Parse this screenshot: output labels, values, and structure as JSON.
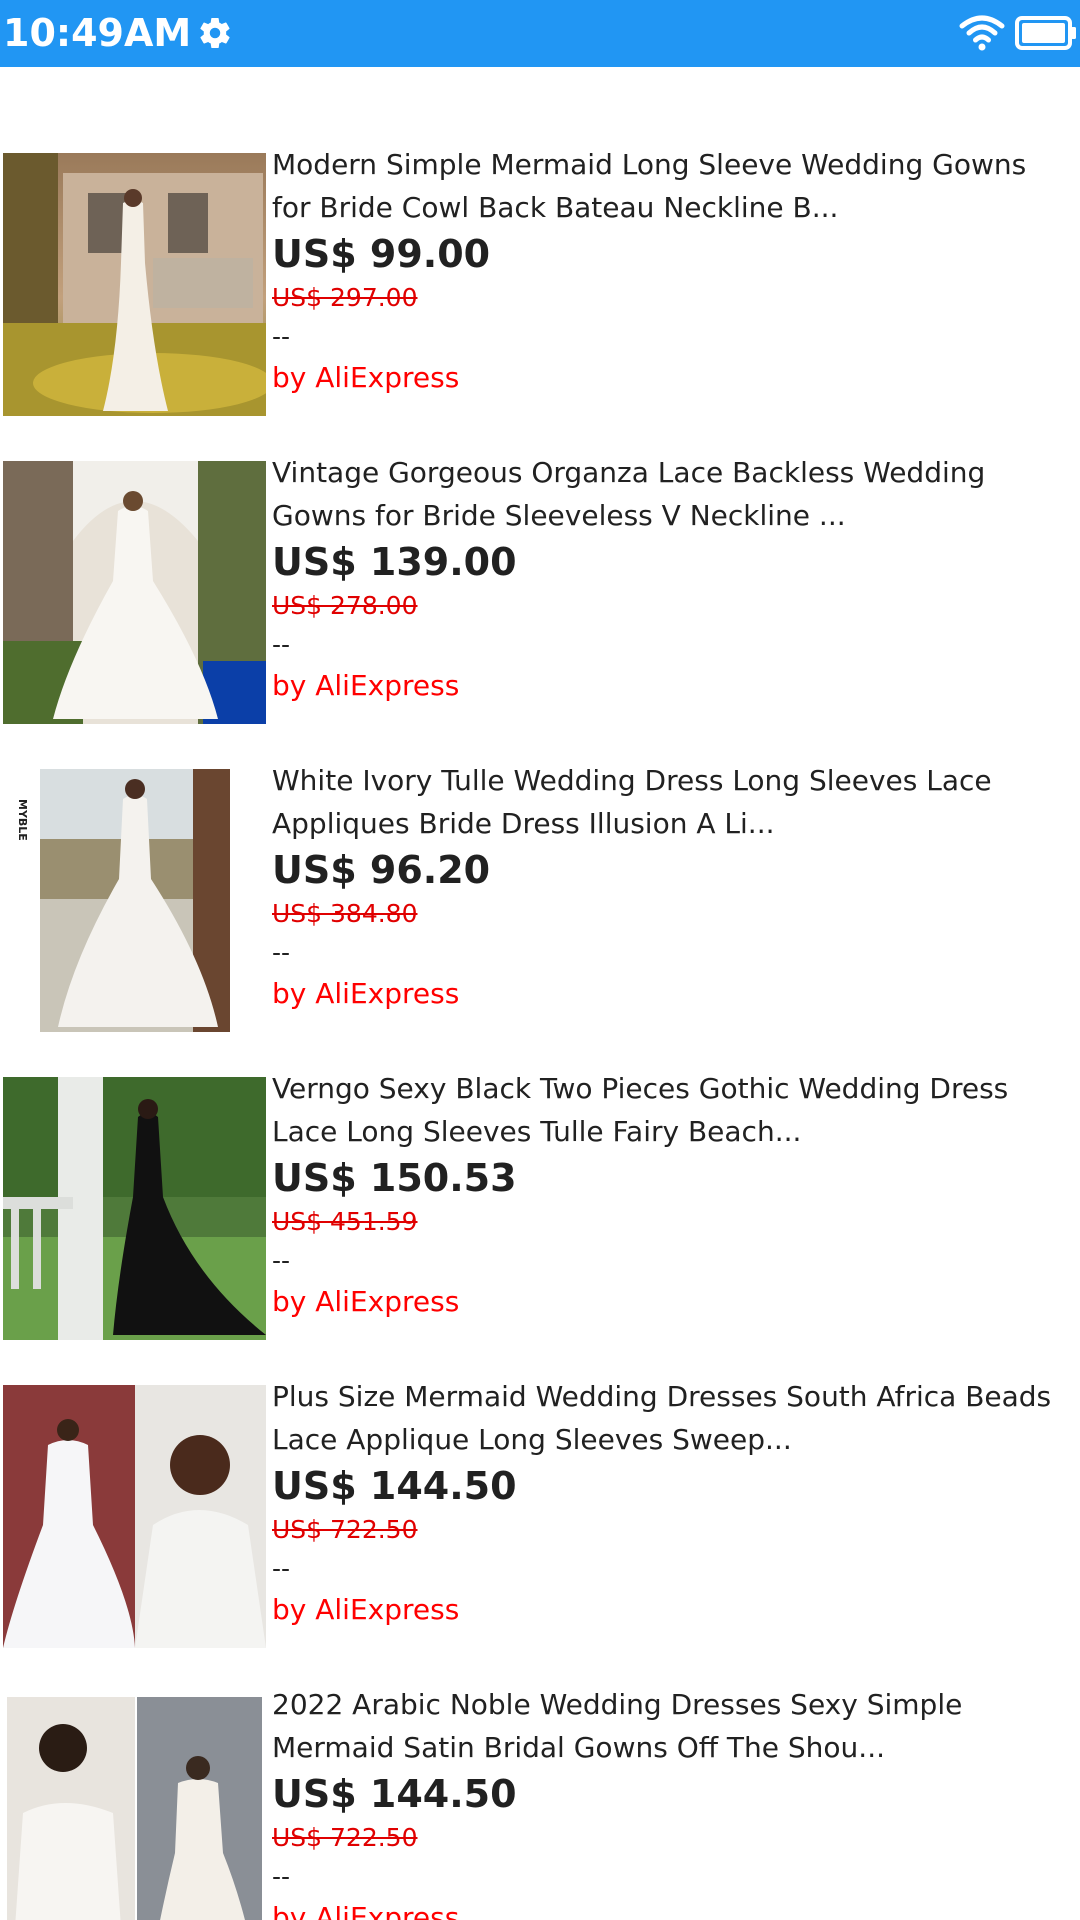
{
  "status_bar": {
    "time": "10:49AM",
    "icons": [
      "gear-icon",
      "wifi-icon",
      "battery-icon"
    ],
    "background": "#2196f3"
  },
  "products": [
    {
      "title_line1": "Modern Simple Mermaid Long Sleeve Wedding Gowns",
      "title_line2": "for Bride Cowl Back Bateau Neckline B...",
      "price": "US$ 99.00",
      "original_price": "US$ 297.00",
      "rating": "--",
      "seller": "by AliExpress"
    },
    {
      "title_line1": "Vintage Gorgeous Organza Lace Backless Wedding",
      "title_line2": "Gowns for Bride Sleeveless V Neckline ...",
      "price": "US$ 139.00",
      "original_price": "US$ 278.00",
      "rating": "--",
      "seller": "by AliExpress"
    },
    {
      "title_line1": "White Ivory Tulle Wedding Dress Long Sleeves Lace",
      "title_line2": "Appliques Bride Dress Illusion A Li...",
      "price": "US$ 96.20",
      "original_price": "US$ 384.80",
      "rating": "--",
      "seller": "by AliExpress",
      "image_text": "MYBLE"
    },
    {
      "title_line1": "Verngo Sexy Black Two Pieces Gothic Wedding Dress",
      "title_line2": "Lace Long Sleeves Tulle Fairy Beach...",
      "price": "US$ 150.53",
      "original_price": "US$ 451.59",
      "rating": "--",
      "seller": "by AliExpress"
    },
    {
      "title_line1": "Plus Size Mermaid Wedding Dresses South Africa Beads",
      "title_line2": "Lace Applique Long Sleeves Sweep...",
      "price": "US$ 144.50",
      "original_price": "US$ 722.50",
      "rating": "--",
      "seller": "by AliExpress"
    },
    {
      "title_line1": "2022 Arabic Noble Wedding Dresses Sexy Simple",
      "title_line2": "Mermaid Satin Bridal Gowns Off The Shou...",
      "price": "US$ 144.50",
      "original_price": "US$ 722.50",
      "rating": "--",
      "seller": "by AliExpress"
    }
  ],
  "colors": {
    "price_text": "#212121",
    "original_price": "#e00000",
    "seller": "#ff0000"
  }
}
